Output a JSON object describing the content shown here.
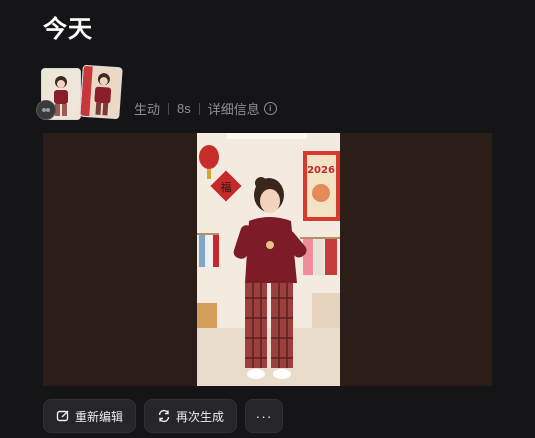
{
  "section": {
    "title": "今天"
  },
  "item": {
    "type_label": "生动",
    "duration": "8s",
    "details_label": "详细信息",
    "video_poster_text": "2026"
  },
  "actions": {
    "reedit_label": "重新编辑",
    "regenerate_label": "再次生成",
    "more_label": "···"
  },
  "icons": {
    "info": "info-circle-icon",
    "edit": "edit-icon",
    "regenerate": "refresh-icon",
    "more": "more-dots-icon",
    "overlay": "image-count-icon"
  }
}
